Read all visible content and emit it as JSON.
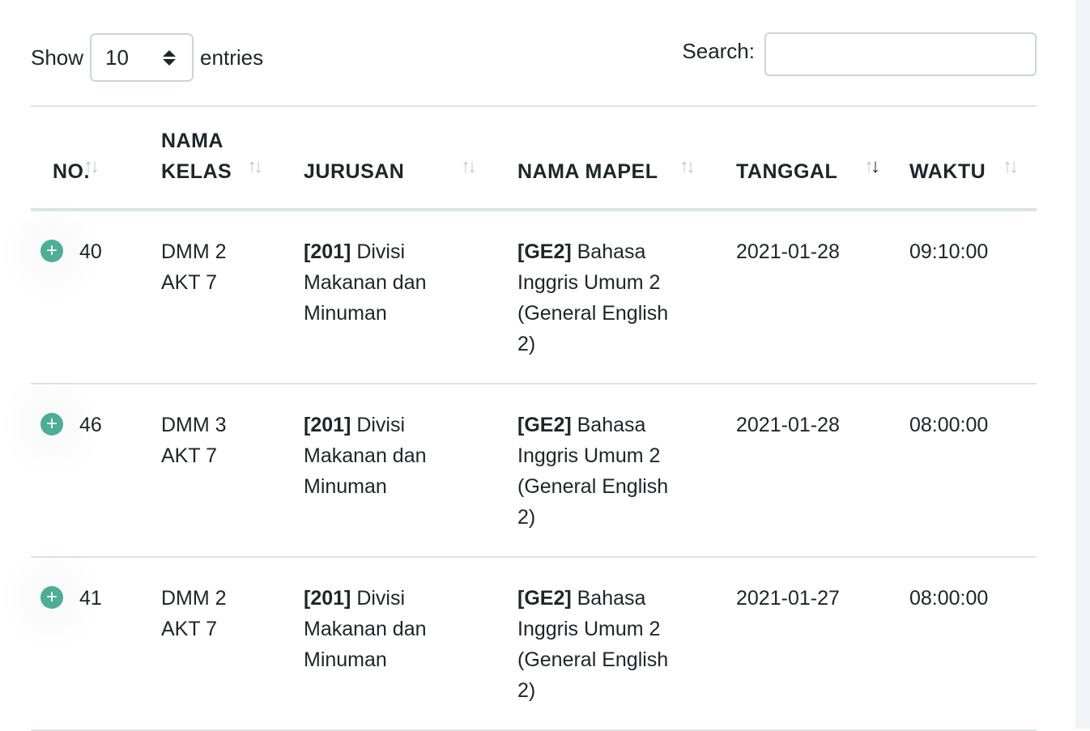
{
  "controls": {
    "show_label": "Show",
    "page_length": "10",
    "entries_label": "entries",
    "search_label": "Search:",
    "search_value": ""
  },
  "columns": [
    {
      "line1": "",
      "line2": "NO.",
      "sorted": false
    },
    {
      "line1": "NAMA",
      "line2": "KELAS",
      "sorted": false
    },
    {
      "line1": "",
      "line2": "JURUSAN",
      "sorted": false
    },
    {
      "line1": "",
      "line2": "NAMA MAPEL",
      "sorted": false
    },
    {
      "line1": "",
      "line2": "TANGGAL",
      "sorted": true
    },
    {
      "line1": "",
      "line2": "WAKTU",
      "sorted": false
    }
  ],
  "rows": [
    {
      "no": "40",
      "kelas": [
        "DMM 2",
        "AKT 7"
      ],
      "jurusan_code": "[201]",
      "jurusan": [
        " Divisi",
        "Makanan dan",
        "Minuman"
      ],
      "mapel_code": "[GE2]",
      "mapel": [
        " Bahasa",
        "Inggris Umum 2",
        "(General English",
        "2)"
      ],
      "tanggal": "2021-01-28",
      "waktu": "09:10:00"
    },
    {
      "no": "46",
      "kelas": [
        "DMM 3",
        "AKT 7"
      ],
      "jurusan_code": "[201]",
      "jurusan": [
        " Divisi",
        "Makanan dan",
        "Minuman"
      ],
      "mapel_code": "[GE2]",
      "mapel": [
        " Bahasa",
        "Inggris Umum 2",
        "(General English",
        "2)"
      ],
      "tanggal": "2021-01-28",
      "waktu": "08:00:00"
    },
    {
      "no": "41",
      "kelas": [
        "DMM 2",
        "AKT 7"
      ],
      "jurusan_code": "[201]",
      "jurusan": [
        " Divisi",
        "Makanan dan",
        "Minuman"
      ],
      "mapel_code": "[GE2]",
      "mapel": [
        " Bahasa",
        "Inggris Umum 2",
        "(General English",
        "2)"
      ],
      "tanggal": "2021-01-27",
      "waktu": "08:00:00"
    }
  ],
  "icons": {
    "expand": "plus-circle-icon",
    "sort": "sort-arrows-icon",
    "select_caret": "up-down-caret-icon"
  },
  "colors": {
    "expand_button": "#4cae94",
    "border": "#dee2e6"
  }
}
